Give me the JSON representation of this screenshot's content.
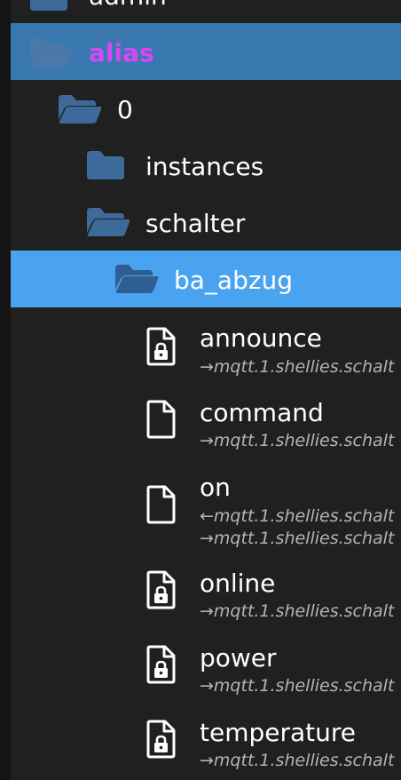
{
  "tree": {
    "admin": {
      "label": "admin",
      "icon": "folder-closed-icon"
    },
    "alias": {
      "label": "alias",
      "icon": "folder-open-icon"
    },
    "zero": {
      "label": "0",
      "icon": "folder-open-icon"
    },
    "instances": {
      "label": "instances",
      "icon": "folder-closed-icon"
    },
    "schalter": {
      "label": "schalter",
      "icon": "folder-open-icon"
    },
    "ba_abzug": {
      "label": "ba_abzug",
      "icon": "folder-open-icon"
    },
    "states": [
      {
        "label": "announce",
        "icon": "file-locked-icon",
        "links": [
          "→mqtt.1.shellies.schalt"
        ]
      },
      {
        "label": "command",
        "icon": "file-icon",
        "links": [
          "→mqtt.1.shellies.schalt"
        ]
      },
      {
        "label": "on",
        "icon": "file-icon",
        "links": [
          "←mqtt.1.shellies.schalt",
          "→mqtt.1.shellies.schalt"
        ]
      },
      {
        "label": "online",
        "icon": "file-locked-icon",
        "links": [
          "→mqtt.1.shellies.schalt"
        ]
      },
      {
        "label": "power",
        "icon": "file-locked-icon",
        "links": [
          "→mqtt.1.shellies.schalt"
        ]
      },
      {
        "label": "temperature",
        "icon": "file-locked-icon",
        "links": [
          "→mqtt.1.shellies.schalt"
        ]
      }
    ]
  },
  "colors": {
    "background": "#202020",
    "alias_row_bg": "#3a78b0",
    "selected_row_bg": "#4aa3ee",
    "alias_text": "#d648f5",
    "folder_icon": "#3d6a9a",
    "link_text": "#b4b4b4"
  }
}
